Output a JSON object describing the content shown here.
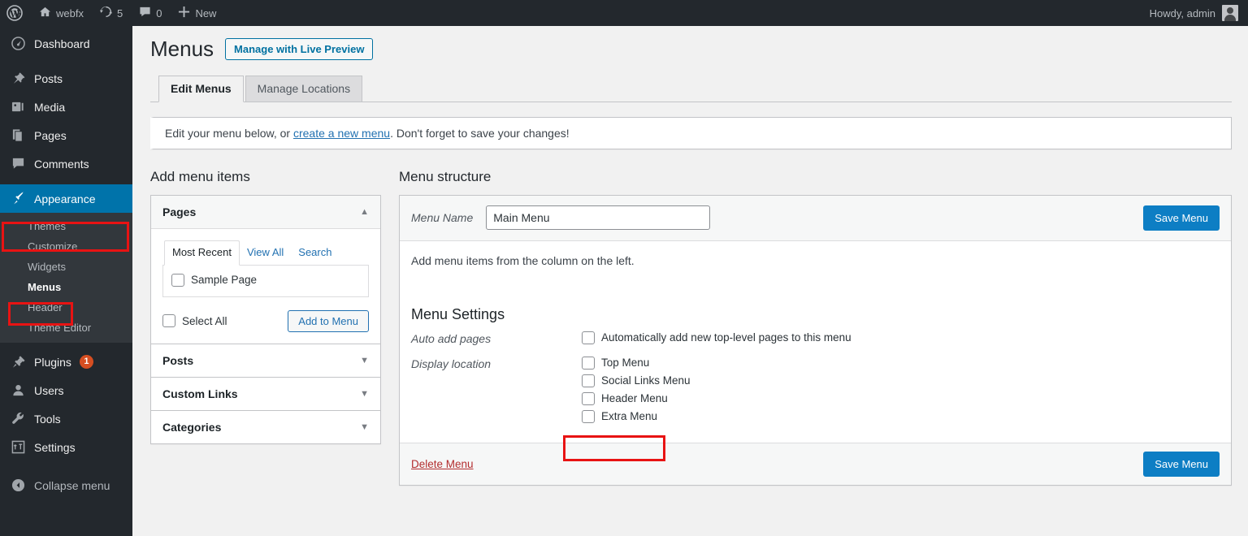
{
  "adminbar": {
    "logo_icon": "wordpress-logo-icon",
    "site_icon": "home-icon",
    "site_name": "webfx",
    "updates_icon": "updates-icon",
    "updates_count": "5",
    "comments_icon": "comment-bubble-icon",
    "comments_count": "0",
    "new_icon": "plus-icon",
    "new_label": "New",
    "howdy": "Howdy, admin",
    "avatar_icon": "avatar-icon"
  },
  "sidebar": {
    "items": [
      {
        "label": "Dashboard",
        "icon": "dashboard-icon"
      },
      {
        "label": "Posts",
        "icon": "pin-icon"
      },
      {
        "label": "Media",
        "icon": "media-icon"
      },
      {
        "label": "Pages",
        "icon": "pages-icon"
      },
      {
        "label": "Comments",
        "icon": "comments-icon"
      },
      {
        "label": "Appearance",
        "icon": "paintbrush-icon"
      }
    ],
    "submenu": [
      {
        "label": "Themes"
      },
      {
        "label": "Customize"
      },
      {
        "label": "Widgets"
      },
      {
        "label": "Menus"
      },
      {
        "label": "Header"
      },
      {
        "label": "Theme Editor"
      }
    ],
    "items_bottom": [
      {
        "label": "Plugins",
        "icon": "plugin-icon",
        "badge": "1"
      },
      {
        "label": "Users",
        "icon": "users-icon"
      },
      {
        "label": "Tools",
        "icon": "wrench-icon"
      },
      {
        "label": "Settings",
        "icon": "settings-icon"
      }
    ],
    "collapse": {
      "label": "Collapse menu",
      "icon": "collapse-arrow-icon"
    },
    "accent_current": "#0073aa",
    "annotation_color": "#e81313"
  },
  "page": {
    "title": "Menus",
    "live_preview_button": "Manage with Live Preview",
    "tabs": [
      {
        "label": "Edit Menus",
        "active": true
      },
      {
        "label": "Manage Locations",
        "active": false
      }
    ],
    "notice_before": "Edit your menu below, or ",
    "notice_link": "create a new menu",
    "notice_after": ". Don't forget to save your changes!"
  },
  "add_items": {
    "heading": "Add menu items",
    "panels": [
      {
        "title": "Pages",
        "open": true,
        "caret": "caret-up-icon"
      },
      {
        "title": "Posts",
        "open": false,
        "caret": "caret-down-icon"
      },
      {
        "title": "Custom Links",
        "open": false,
        "caret": "caret-down-icon"
      },
      {
        "title": "Categories",
        "open": false,
        "caret": "caret-down-icon"
      }
    ],
    "pages_tabs": [
      {
        "label": "Most Recent",
        "active": true
      },
      {
        "label": "View All",
        "active": false
      },
      {
        "label": "Search",
        "active": false
      }
    ],
    "page_items": [
      {
        "label": "Sample Page",
        "checked": false
      }
    ],
    "select_all_label": "Select All",
    "add_to_menu_button": "Add to Menu"
  },
  "menu_structure": {
    "heading": "Menu structure",
    "name_label": "Menu Name",
    "name_value": "Main Menu",
    "name_placeholder": "Menu Name",
    "save_top_button": "Save Menu",
    "hint": "Add menu items from the column on the left.",
    "settings_heading": "Menu Settings",
    "auto_add_label": "Auto add pages",
    "auto_add_option": "Automatically add new top-level pages to this menu",
    "display_location_label": "Display location",
    "locations": [
      {
        "label": "Top Menu",
        "checked": false
      },
      {
        "label": "Social Links Menu",
        "checked": false
      },
      {
        "label": "Header Menu",
        "checked": false
      },
      {
        "label": "Extra Menu",
        "checked": false
      }
    ],
    "delete_link": "Delete Menu",
    "save_bottom_button": "Save Menu"
  }
}
